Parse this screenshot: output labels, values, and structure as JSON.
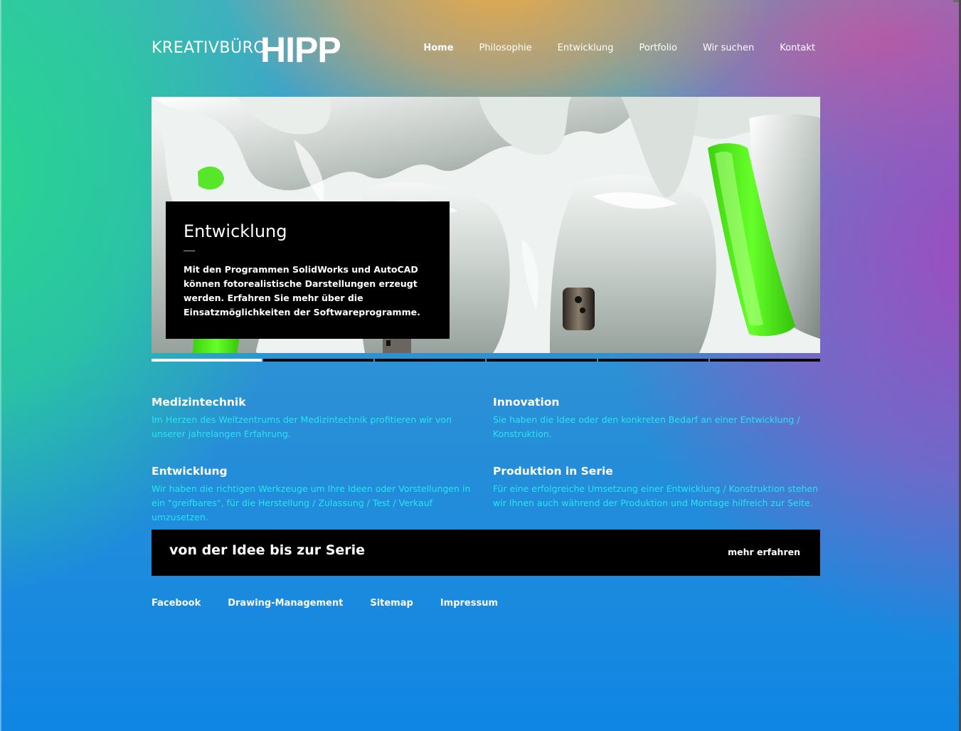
{
  "brand": {
    "small": "KREATIVBÜRO",
    "big": "HIPP"
  },
  "nav": [
    {
      "label": "Home",
      "active": true
    },
    {
      "label": "Philosophie"
    },
    {
      "label": "Entwicklung"
    },
    {
      "label": "Portfolio"
    },
    {
      "label": "Wir suchen"
    },
    {
      "label": "Kontakt"
    }
  ],
  "hero": {
    "title": "Entwicklung",
    "text": "Mit den Programmen SolidWorks und AutoCAD können fotorealistische Darstellungen erzeugt werden. Erfahren Sie mehr über die Einsatzmöglichkeiten der Softwareprogramme.",
    "slides_total": 6,
    "active_slide": 1
  },
  "features": [
    {
      "title": "Medizintechnik",
      "text": "Im Herzen des Weltzentrums der Medizintechnik profitieren wir von unserer jahrelangen Erfahrung."
    },
    {
      "title": "Innovation",
      "text": "Sie haben die Idee oder den konkreten Bedarf an einer Entwicklung / Konstruktion."
    },
    {
      "title": "Entwicklung",
      "text": "Wir haben die richtigen Werkzeuge um Ihre Ideen oder Vorstellungen in ein \"greifbares\", für die Herstellung / Zulassung / Test / Verkauf umzusetzen."
    },
    {
      "title": "Produktion in Serie",
      "text": "Für eine erfolgreiche Umsetzung einer Entwicklung / Konstruktion stehen wir Ihnen auch während der Produktion und Montage hilfreich zur Seite."
    }
  ],
  "cta": {
    "title": "von der Idee bis zur Serie",
    "link": "mehr erfahren"
  },
  "footer": [
    "Facebook",
    "Drawing-Management",
    "Sitemap",
    "Impressum"
  ],
  "colors": {
    "feature_text": "#27e5f0",
    "accent_green": "#52f51c",
    "panel": "#000000"
  }
}
